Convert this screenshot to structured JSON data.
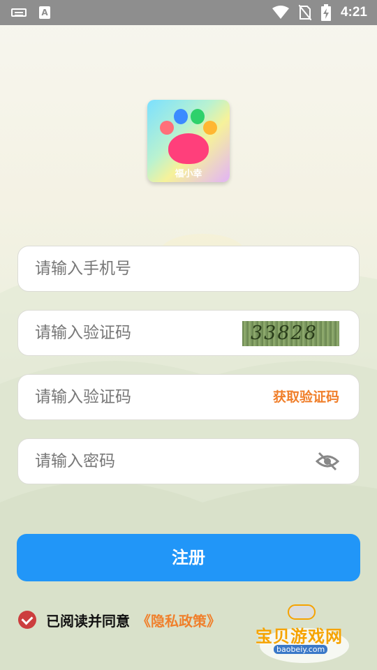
{
  "status_bar": {
    "time": "4:21",
    "icons": [
      "keyboard-icon",
      "a-icon",
      "wifi-icon",
      "no-sim-icon",
      "battery-charging-icon"
    ]
  },
  "app": {
    "logo_text": "福小幸"
  },
  "form": {
    "phone_placeholder": "请输入手机号",
    "image_captcha_placeholder": "请输入验证码",
    "captcha_text": "33828",
    "sms_code_placeholder": "请输入验证码",
    "get_code_label": "获取验证码",
    "password_placeholder": "请输入密码",
    "register_label": "注册"
  },
  "agreement": {
    "checked": true,
    "text": "已阅读并同意",
    "policy_link": "《隐私政策》"
  },
  "watermark": {
    "title": "宝贝游戏网",
    "url": "baobeiy.com"
  },
  "colors": {
    "primary": "#2196f8",
    "accent": "#f07f2b",
    "check": "#cc3e3e"
  }
}
